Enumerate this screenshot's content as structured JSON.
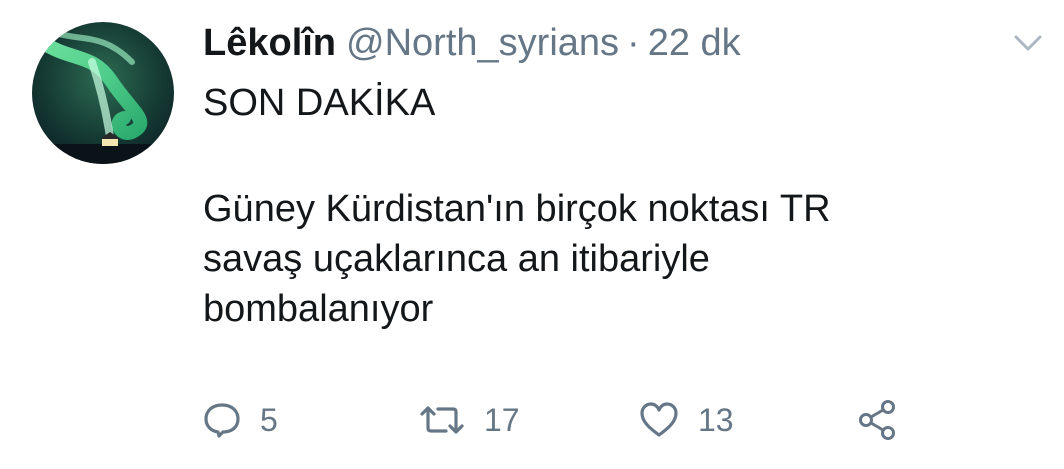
{
  "tweet": {
    "display_name": "Lêkolîn",
    "handle": "@North_syrians",
    "separator": "·",
    "time": "22 dk",
    "text_lines": [
      "SON DAKİKA",
      "Güney Kürdistan'ın birçok noktası TR",
      "savaş uçaklarınca an itibariyle",
      "bombalanıyor"
    ],
    "counts": {
      "replies": "5",
      "retweets": "17",
      "likes": "13"
    }
  },
  "icons": {
    "caret": "chevron-down-icon",
    "reply": "reply-icon",
    "retweet": "retweet-icon",
    "like": "heart-icon",
    "share": "share-icon"
  },
  "colors": {
    "text": "#14171a",
    "muted": "#657786"
  }
}
